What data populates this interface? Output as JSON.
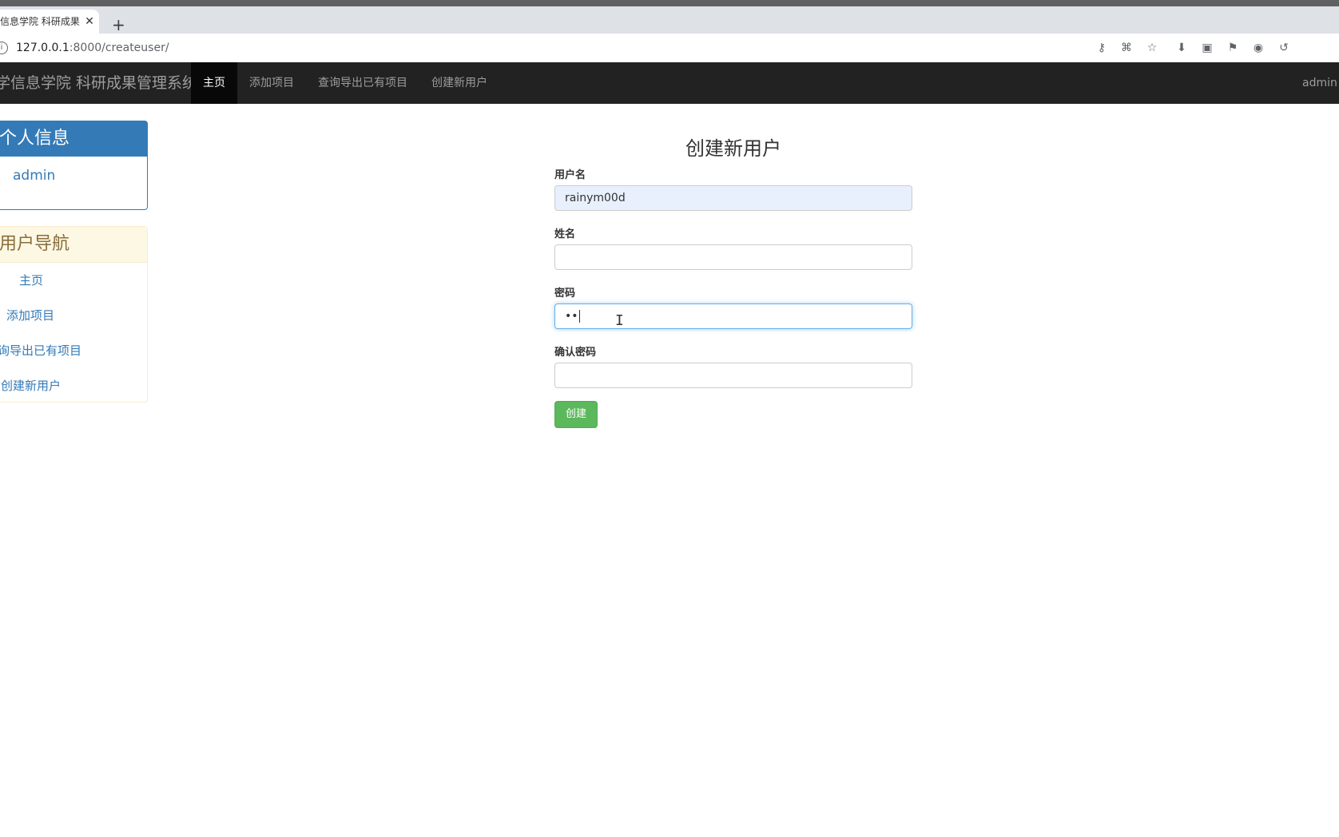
{
  "browser": {
    "tab_title": "信息学院 科研成果",
    "tab_close": "✕",
    "new_tab": "+",
    "url_host": "127.0.0.1",
    "url_rest": ":8000/createuser/",
    "extensions": [
      "key-icon",
      "translate-icon",
      "star-icon",
      "download-icon",
      "tampermonkey-icon",
      "bookmark-icon",
      "glasses-icon",
      "history-icon"
    ]
  },
  "navbar": {
    "brand": "学信息学院 科研成果管理系统",
    "items": [
      {
        "label": "主页",
        "active": true
      },
      {
        "label": "添加项目",
        "active": false
      },
      {
        "label": "查询导出已有项目",
        "active": false
      },
      {
        "label": "创建新用户",
        "active": false
      }
    ],
    "user": "admin"
  },
  "sidebar": {
    "profile_title": "个人信息",
    "profile_user": "admin",
    "nav_title": "用户导航",
    "nav_items": [
      "主页",
      "添加项目",
      "询导出已有项目",
      "创建新用户"
    ]
  },
  "form": {
    "title": "创建新用户",
    "username_label": "用户名",
    "username_value": "rainym00d",
    "name_label": "姓名",
    "name_value": "",
    "password_label": "密码",
    "password_value": "••",
    "confirm_label": "确认密码",
    "confirm_value": "",
    "submit_label": "创建"
  }
}
